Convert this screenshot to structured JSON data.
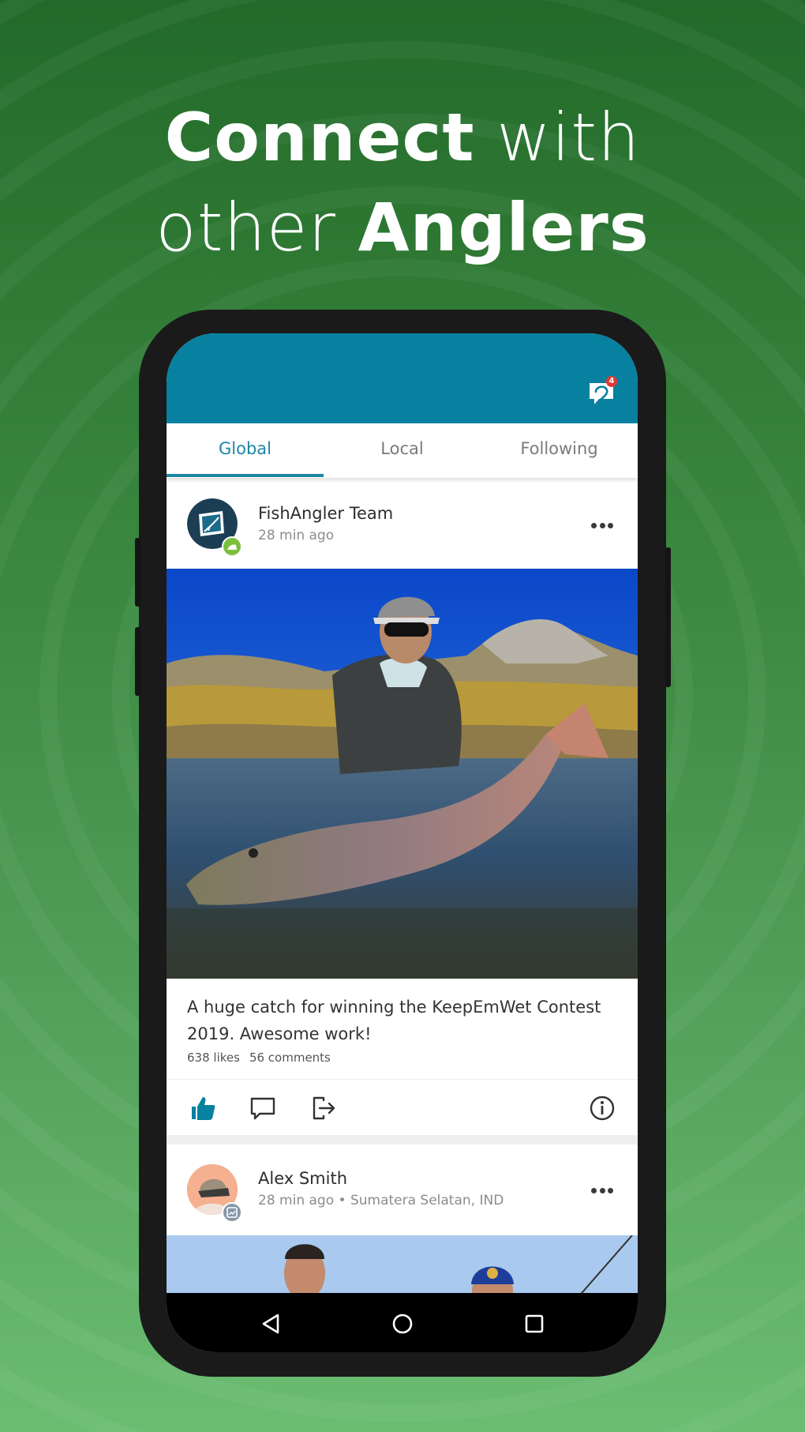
{
  "headline": {
    "line1_bold": "Connect",
    "line1_light": " with",
    "line2_light": "other ",
    "line2_bold": "Anglers"
  },
  "app": {
    "accent_color": "#08809f",
    "tab_active_color": "#1d86a5",
    "messages_badge_count": "4"
  },
  "tabs": [
    {
      "label": "Global",
      "active": true
    },
    {
      "label": "Local",
      "active": false
    },
    {
      "label": "Following",
      "active": false
    }
  ],
  "posts": [
    {
      "author": "FishAngler Team",
      "meta": "28 min ago",
      "photo_description": "Angler in cap and sunglasses holding a large spotted taimen fish in a river with autumn mountains behind",
      "caption": "A huge catch for winning the KeepEmWet Contest 2019. Awesome work!",
      "likes": "638 likes",
      "comments": "56 comments",
      "liked": true
    },
    {
      "author": "Alex Smith",
      "meta": "28 min ago • Sumatera Selatan, IND",
      "photo_description": "Two men on a boat under blue sky with fishing rod"
    }
  ],
  "icons": {
    "messages": "fish-hook-chat-icon",
    "more": "more-horizontal-icon",
    "like": "thumbs-up-icon",
    "comment": "comment-icon",
    "share": "share-icon",
    "info": "info-icon",
    "back": "back-triangle-icon",
    "home": "home-circle-icon",
    "recents": "recents-square-icon"
  }
}
